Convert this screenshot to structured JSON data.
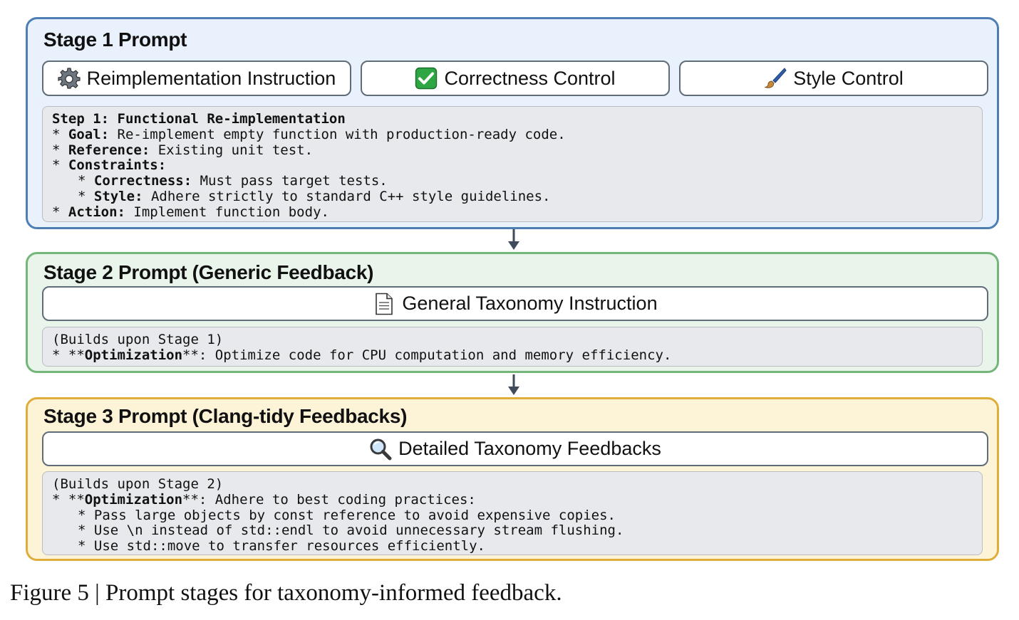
{
  "stage1": {
    "title": "Stage 1 Prompt",
    "pills": [
      {
        "label": "Reimplementation Instruction",
        "icon": "gear-icon"
      },
      {
        "label": "Correctness Control",
        "icon": "check-mark-icon",
        "icon_color": "#2fa644"
      },
      {
        "label": "Style Control",
        "icon": "paintbrush-icon"
      }
    ],
    "code": {
      "heading": "Step 1: Functional Re-implementation",
      "goal_key": "Goal:",
      "goal_val": " Re-implement empty function with production-ready code.",
      "ref_key": "Reference:",
      "ref_val": " Existing unit test.",
      "constraints_key": "Constraints:",
      "correct_key": "Correctness:",
      "correct_val": " Must pass target tests.",
      "style_key": "Style:",
      "style_val": " Adhere strictly to standard C++ style guidelines.",
      "action_key": "Action:",
      "action_val": " Implement function body."
    }
  },
  "stage2": {
    "title": "Stage 2 Prompt (Generic Feedback)",
    "pill": {
      "label": "General Taxonomy Instruction",
      "icon": "document-icon"
    },
    "code": {
      "line1": "(Builds upon Stage 1)",
      "opt_pre": "* **",
      "opt_key": "Optimization",
      "opt_post": "**: Optimize code for CPU computation and memory efficiency."
    }
  },
  "stage3": {
    "title": "Stage 3 Prompt (Clang-tidy Feedbacks)",
    "pill": {
      "label": "Detailed Taxonomy Feedbacks",
      "icon": "magnifier-icon"
    },
    "code": {
      "line1": "(Builds upon Stage 2)",
      "opt_pre": "* **",
      "opt_key": "Optimization",
      "opt_post": "**: Adhere to best coding practices:",
      "items": [
        "Pass large objects by const reference to avoid expensive copies.",
        "Use \\n instead of std::endl to avoid unnecessary stream flushing.",
        "Use std::move to transfer resources efficiently."
      ]
    }
  },
  "caption": "Figure 5 | Prompt stages for taxonomy-informed feedback.",
  "colors": {
    "stage1_fill": "#e9f2fc",
    "stage1_border": "#4e7fb4",
    "stage2_fill": "#e9f5ea",
    "stage2_border": "#74b57a",
    "stage3_fill": "#fdf4d8",
    "stage3_border": "#e0ad3b",
    "arrow": "#3f4b5a"
  }
}
